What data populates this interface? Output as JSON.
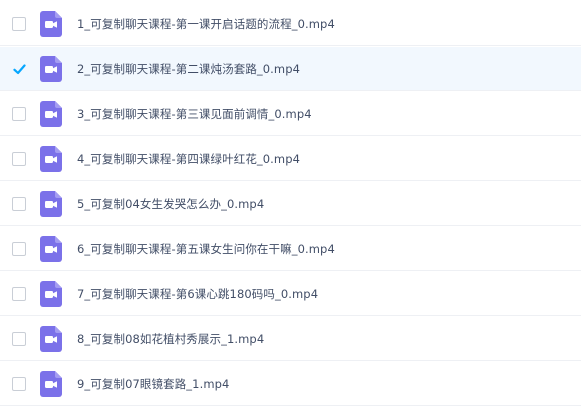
{
  "files": [
    {
      "name": "1_可复制聊天课程-第一课开启话题的流程_0.mp4",
      "checked": false
    },
    {
      "name": "2_可复制聊天课程-第二课炖汤套路_0.mp4",
      "checked": true
    },
    {
      "name": "3_可复制聊天课程-第三课见面前调情_0.mp4",
      "checked": false
    },
    {
      "name": "4_可复制聊天课程-第四课绿叶红花_0.mp4",
      "checked": false
    },
    {
      "name": "5_可复制04女生发哭怎么办_0.mp4",
      "checked": false
    },
    {
      "name": "6_可复制聊天课程-第五课女生问你在干嘛_0.mp4",
      "checked": false
    },
    {
      "name": "7_可复制聊天课程-第6课心跳180码吗_0.mp4",
      "checked": false
    },
    {
      "name": "8_可复制08如花植村秀展示_1.mp4",
      "checked": false
    },
    {
      "name": "9_可复制07眼镜套路_1.mp4",
      "checked": false
    }
  ],
  "colors": {
    "accent": "#06a7ff",
    "icon": "#7b71e9",
    "selected_row": "#f2f8fe",
    "text": "#424e67"
  },
  "icons": {
    "file": "video-file-icon",
    "check": "checkmark-icon"
  }
}
